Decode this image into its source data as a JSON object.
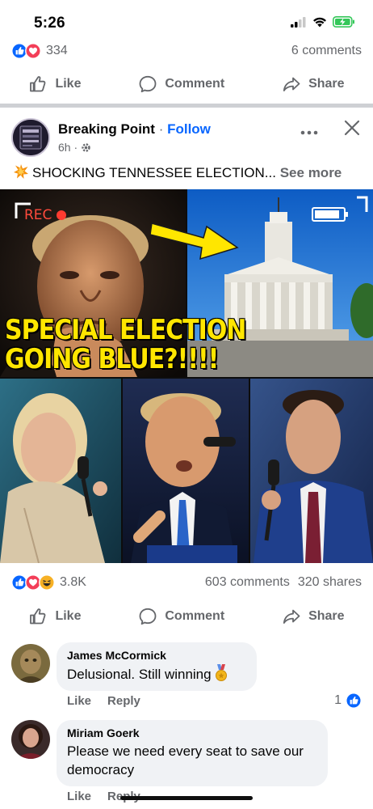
{
  "status_bar": {
    "time": "5:26"
  },
  "previous_post": {
    "reaction_count": "334",
    "comments": "6 comments"
  },
  "actions": {
    "like": "Like",
    "comment": "Comment",
    "share": "Share"
  },
  "post": {
    "page_name": "Breaking Point",
    "separator": " · ",
    "follow": "Follow",
    "time": "6h ·",
    "text": "SHOCKING TENNESSEE ELECTION...",
    "see_more": "See more",
    "image": {
      "rec_label": "REC",
      "headline_line1": "SPECIAL ELECTION",
      "headline_line2": "GOING BLUE?!!!!"
    },
    "reaction_count": "3.8K",
    "comments": "603 comments",
    "shares": "320 shares"
  },
  "comments": [
    {
      "author": "James McCormick",
      "text": "Delusional. Still winning",
      "like": "Like",
      "reply": "Reply",
      "like_count": "1"
    },
    {
      "author": "Miriam Goerk",
      "text": "Please we need every seat to save our democracy",
      "like": "Like",
      "reply": "Reply"
    }
  ],
  "colors": {
    "facebook_blue": "#0866ff",
    "love_red": "#f33e58",
    "headline_yellow": "#ffe600",
    "secondary_text": "#65676b",
    "comment_bubble": "#f0f2f5"
  }
}
